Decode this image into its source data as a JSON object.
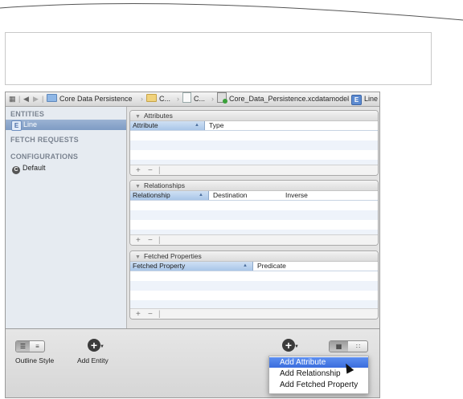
{
  "jumpbar": {
    "crumbs": [
      "Core Data Persistence",
      "C...",
      "C...",
      "Core_Data_Persistence.xcdatamodel",
      "Line"
    ],
    "entity_badge": "E"
  },
  "sidebar": {
    "entities_header": "ENTITIES",
    "entity_badge": "E",
    "entities": [
      "Line"
    ],
    "fetch_requests_header": "FETCH REQUESTS",
    "configurations_header": "CONFIGURATIONS",
    "config_badge": "C",
    "configurations": [
      "Default"
    ]
  },
  "attributes": {
    "title": "Attributes",
    "columns": [
      "Attribute",
      "Type"
    ]
  },
  "relationships": {
    "title": "Relationships",
    "columns": [
      "Relationship",
      "Destination",
      "Inverse"
    ]
  },
  "fetched": {
    "title": "Fetched Properties",
    "columns": [
      "Fetched Property",
      "Predicate"
    ]
  },
  "footer_controls": {
    "add": "+",
    "remove": "−"
  },
  "bottombar": {
    "outline_style_label": "Outline Style",
    "add_entity_label": "Add Entity"
  },
  "menu": {
    "items": [
      "Add Attribute",
      "Add Relationship",
      "Add Fetched Property"
    ],
    "highlighted": "Add Attribute"
  },
  "icons": {
    "nav": [
      "grid-icon",
      "back-arrow-icon",
      "forward-arrow-icon"
    ],
    "add_circle": "plus-circle-icon"
  }
}
